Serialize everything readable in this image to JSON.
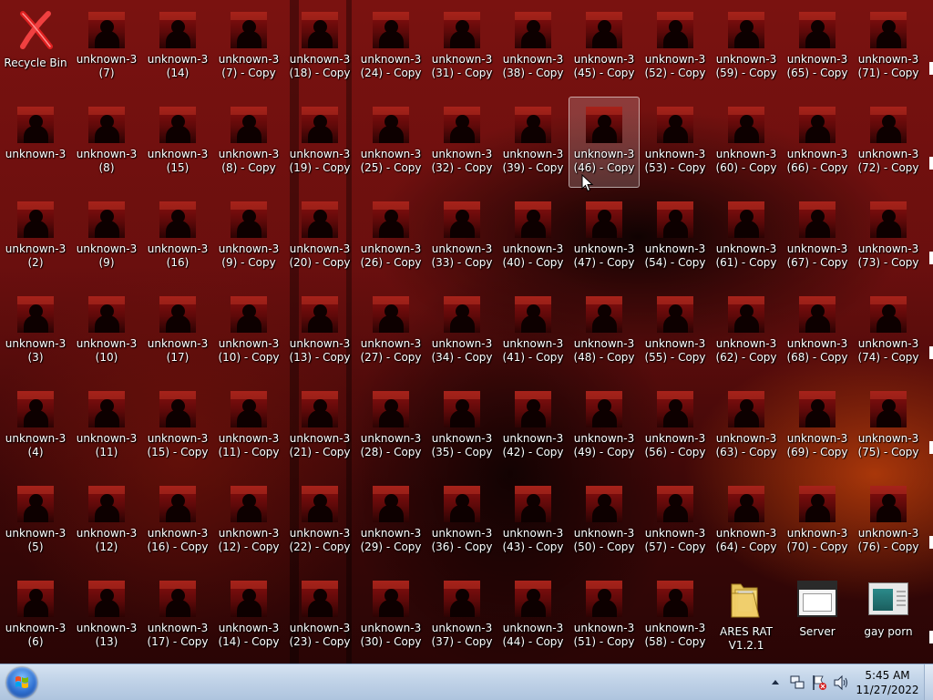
{
  "desktop": {
    "recycle_bin": "Recycle Bin",
    "columns": [
      [
        "unknown-3\n(7)",
        "unknown-3\n(8)",
        "unknown-3\n(9)",
        "unknown-3\n(10)",
        "unknown-3\n(11)",
        "unknown-3\n(12)",
        "unknown-3\n(13)"
      ],
      [
        "unknown-3\n(14)",
        "unknown-3\n(15)",
        "unknown-3\n(16)",
        "unknown-3\n(17)",
        "unknown-3\n(15) - Copy",
        "unknown-3\n(16) - Copy",
        "unknown-3\n(17) - Copy"
      ],
      [
        "unknown-3\n(7) - Copy",
        "unknown-3\n(8) - Copy",
        "unknown-3\n(9) - Copy",
        "unknown-3\n(10) - Copy",
        "unknown-3\n(11) - Copy",
        "unknown-3\n(12) - Copy",
        "unknown-3\n(14) - Copy"
      ],
      [
        "unknown-3\n(18) - Copy",
        "unknown-3\n(19) - Copy",
        "unknown-3\n(20) - Copy",
        "unknown-3\n(13) - Copy",
        "unknown-3\n(21) - Copy",
        "unknown-3\n(22) - Copy",
        "unknown-3\n(23) - Copy"
      ],
      [
        "unknown-3\n(24) - Copy",
        "unknown-3\n(25) - Copy",
        "unknown-3\n(26) - Copy",
        "unknown-3\n(27) - Copy",
        "unknown-3\n(28) - Copy",
        "unknown-3\n(29) - Copy",
        "unknown-3\n(30) - Copy"
      ],
      [
        "unknown-3\n(31) - Copy",
        "unknown-3\n(32) - Copy",
        "unknown-3\n(33) - Copy",
        "unknown-3\n(34) - Copy",
        "unknown-3\n(35) - Copy",
        "unknown-3\n(36) - Copy",
        "unknown-3\n(37) - Copy"
      ],
      [
        "unknown-3\n(38) - Copy",
        "unknown-3\n(39) - Copy",
        "unknown-3\n(40) - Copy",
        "unknown-3\n(41) - Copy",
        "unknown-3\n(42) - Copy",
        "unknown-3\n(43) - Copy",
        "unknown-3\n(44) - Copy"
      ],
      [
        "unknown-3\n(45) - Copy",
        "unknown-3\n(46) - Copy",
        "unknown-3\n(47) - Copy",
        "unknown-3\n(48) - Copy",
        "unknown-3\n(49) - Copy",
        "unknown-3\n(50) - Copy",
        "unknown-3\n(51) - Copy"
      ],
      [
        "unknown-3\n(52) - Copy",
        "unknown-3\n(53) - Copy",
        "unknown-3\n(54) - Copy",
        "unknown-3\n(55) - Copy",
        "unknown-3\n(56) - Copy",
        "unknown-3\n(57) - Copy",
        "unknown-3\n(58) - Copy"
      ],
      [
        "unknown-3\n(59) - Copy",
        "unknown-3\n(60) - Copy",
        "unknown-3\n(61) - Copy",
        "unknown-3\n(62) - Copy",
        "unknown-3\n(63) - Copy",
        "unknown-3\n(64) - Copy",
        "ARES RAT\nV1.2.1"
      ],
      [
        "unknown-3\n(65) - Copy",
        "unknown-3\n(66) - Copy",
        "unknown-3\n(67) - Copy",
        "unknown-3\n(68) - Copy",
        "unknown-3\n(69) - Copy",
        "unknown-3\n(70) - Copy",
        "Server"
      ],
      [
        "unknown-3\n(71) - Copy",
        "unknown-3\n(72) - Copy",
        "unknown-3\n(73) - Copy",
        "unknown-3\n(74) - Copy",
        "unknown-3\n(75) - Copy",
        "unknown-3\n(76) - Copy",
        "gay porn"
      ]
    ],
    "first_column": [
      "unknown-3",
      "unknown-3\n(2)",
      "unknown-3\n(3)",
      "unknown-3\n(4)",
      "unknown-3\n(5)",
      "unknown-3\n(6)"
    ],
    "selected_item": "unknown-3\n(46) - Copy",
    "special_icons": {
      "ARES RAT\nV1.2.1": "folder-icon",
      "Server": "application-window-icon",
      "gay porn": "image-file-icon"
    }
  },
  "taskbar": {
    "start_icon": "windows-start-orb-icon",
    "tray_icons": [
      "show-hidden-icons-arrow-icon",
      "network-icon",
      "action-center-flag-icon",
      "volume-icon"
    ],
    "clock_time": "5:45 AM",
    "clock_date": "11/27/2022"
  }
}
